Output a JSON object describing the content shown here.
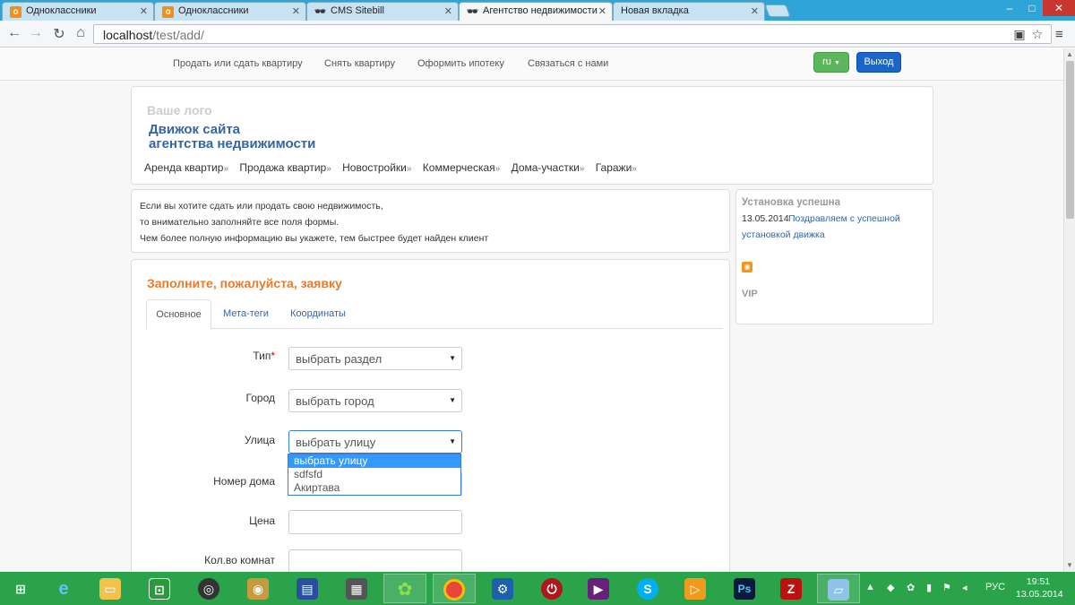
{
  "browser": {
    "tabs": [
      {
        "title": "Одноклассники",
        "icon": "odnoklassniki-icon"
      },
      {
        "title": "Одноклассники",
        "icon": "odnoklassniki-icon"
      },
      {
        "title": "CMS Sitebill",
        "icon": "spy-icon"
      },
      {
        "title": "Агентство недвижимости",
        "icon": "spy-icon"
      },
      {
        "title": "Новая вкладка",
        "icon": ""
      }
    ],
    "url_host": "localhost",
    "url_path": "/test/add/"
  },
  "topnav": {
    "links": [
      "Продать или сдать квартиру",
      "Снять квартиру",
      "Оформить ипотеку",
      "Связаться с нами"
    ],
    "lang_button": "ru",
    "exit_button": "Выход"
  },
  "header": {
    "logo_placeholder": "Ваше лого",
    "site_name_line1": "Движок сайта",
    "site_name_line2": "агентства недвижимости",
    "menu": [
      "Аренда квартир",
      "Продажа квартир",
      "Новостройки",
      "Коммерческая",
      "Дома-участки",
      "Гаражи"
    ],
    "menu_arrow": "»"
  },
  "info": {
    "lines": [
      "Если вы хотите сдать или продать свою недвижимость,",
      "то внимательно заполняйте все поля формы.",
      "Чем более полную информацию вы укажете, тем быстрее будет найден клиент"
    ]
  },
  "sidebar": {
    "title": "Установка успешна",
    "date": "13.05.2014",
    "news_line1": "Поздравляем с успешной",
    "news_line2": "установкой движка",
    "vip": "VIP"
  },
  "form": {
    "title": "Заполните, пожалуйста, заявку",
    "tabs": [
      "Основное",
      "Мета-теги",
      "Координаты"
    ],
    "fields": {
      "type_label": "Тип",
      "type_required_mark": "*",
      "type_value": "выбрать раздел",
      "city_label": "Город",
      "city_value": "выбрать город",
      "street_label": "Улица",
      "street_value": "выбрать улицу",
      "house_label": "Номер дома",
      "price_label": "Цена",
      "rooms_label": "Кол.во комнат"
    },
    "street_options": [
      "выбрать улицу",
      "sdfsfd",
      "Акиртава"
    ],
    "street_selected_index": 0
  },
  "taskbar": {
    "language": "РУС",
    "time": "19:51",
    "date": "13.05.2014"
  },
  "colors": {
    "accent_blue": "#3465a4",
    "form_title_orange": "#e87a2a",
    "taskbar_green": "#2aa34a",
    "tabstrip_blue": "#2fa4d6"
  }
}
